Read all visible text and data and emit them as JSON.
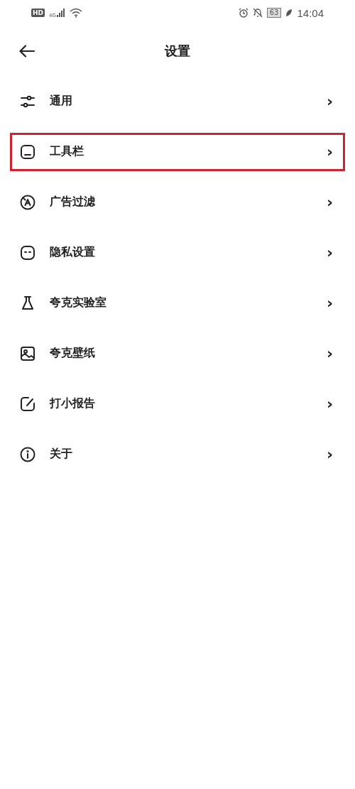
{
  "status_bar": {
    "hd": "HD",
    "network": "4G",
    "battery": "63",
    "time": "14:04"
  },
  "header": {
    "title": "设置"
  },
  "items": [
    {
      "label": "通用",
      "kind": "sliders",
      "highlighted": false,
      "chevron": "›"
    },
    {
      "label": "工具栏",
      "kind": "toolbar",
      "highlighted": true,
      "chevron": "›"
    },
    {
      "label": "广告过滤",
      "kind": "adblock",
      "highlighted": false,
      "chevron": "›"
    },
    {
      "label": "隐私设置",
      "kind": "privacy",
      "highlighted": false,
      "chevron": "›"
    },
    {
      "label": "夸克实验室",
      "kind": "flask",
      "highlighted": false,
      "chevron": "›"
    },
    {
      "label": "夸克壁纸",
      "kind": "image",
      "highlighted": false,
      "chevron": "›"
    },
    {
      "label": "打小报告",
      "kind": "edit",
      "highlighted": false,
      "chevron": "›"
    },
    {
      "label": "关于",
      "kind": "info",
      "highlighted": false,
      "chevron": "›"
    }
  ]
}
